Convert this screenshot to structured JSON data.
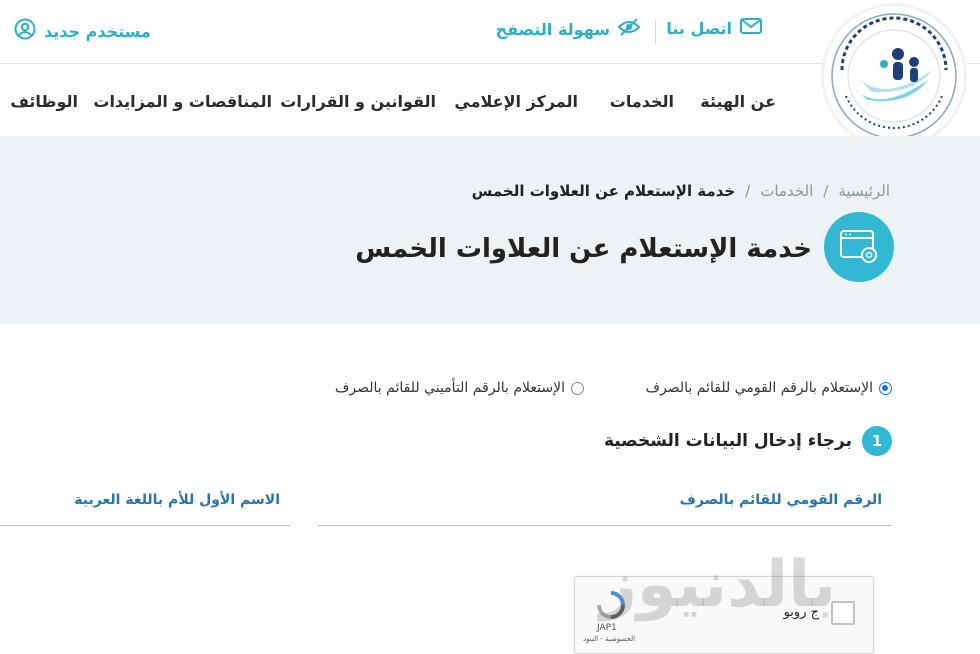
{
  "topbar": {
    "contact": "اتصل بنا",
    "accessibility": "سهولة التصفح",
    "new_user": "مستخدم جديد"
  },
  "nav": {
    "items": [
      "عن الهيئة",
      "الخدمات",
      "المركز الإعلامي",
      "القوانين و القرارات",
      "المناقصات و المزايدات",
      "الوظائف"
    ]
  },
  "breadcrumb": {
    "home": "الرئيسية",
    "services": "الخدمات",
    "current": "خدمة الإستعلام عن العلاوات الخمس",
    "separator": "/"
  },
  "page": {
    "title": "خدمة الإستعلام عن العلاوات الخمس"
  },
  "form": {
    "radio_national": "الإستعلام بالرقم القومي للقائم بالصرف",
    "radio_insurance": "الإستعلام بالرقم التأميني للقائم بالصرف",
    "step_number": "1",
    "step_title": "برجاء إدخال البيانات الشخصية",
    "national_id_label": "الرقم القومي للقائم بالصرف",
    "mother_name_label": "الاسم الأول للأم باللغة العربية"
  },
  "captcha": {
    "label": "ج روبو",
    "brand": "JAP1",
    "links": "الخصوصية - البنود"
  },
  "watermark": {
    "text": "بالدنيوز"
  },
  "colors": {
    "accent": "#32b8d2",
    "link_text": "#2a74a8",
    "banner_bg": "#eef2f4"
  },
  "icons": {
    "contact": "envelope-icon",
    "accessibility": "eye-slash-icon",
    "new_user": "user-circle-icon",
    "service": "browser-settings-icon"
  }
}
